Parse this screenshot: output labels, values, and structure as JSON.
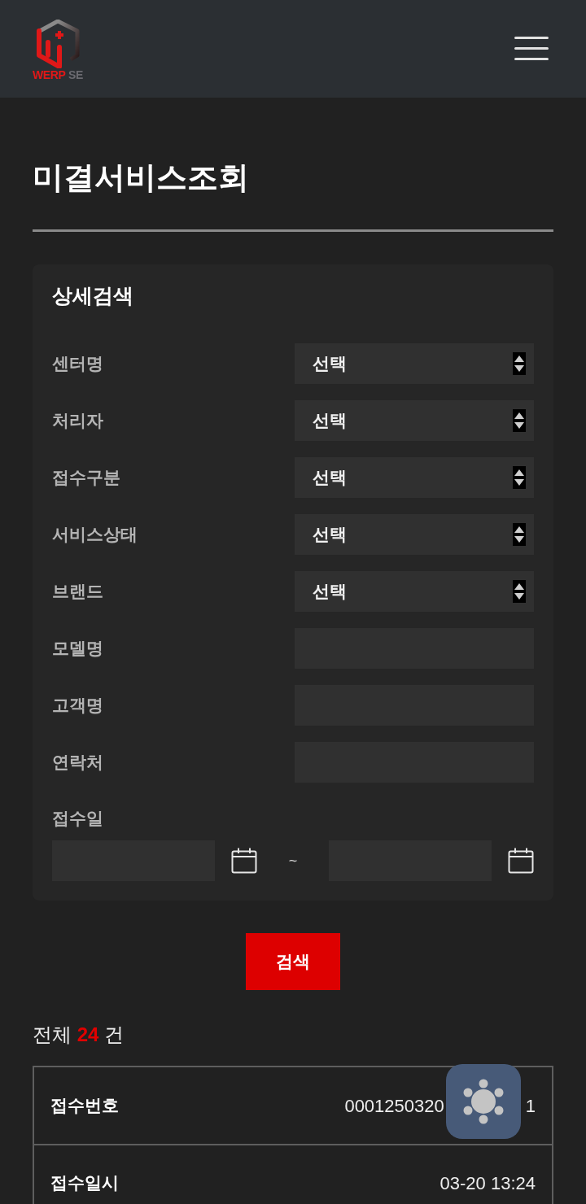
{
  "header": {
    "logo": {
      "brand": "WERP",
      "suffix": "SE"
    }
  },
  "page_title": "미결서비스조회",
  "search_panel": {
    "title": "상세검색",
    "fields": [
      {
        "label": "센터명",
        "kind": "select",
        "value": "선택"
      },
      {
        "label": "처리자",
        "kind": "select",
        "value": "선택"
      },
      {
        "label": "접수구분",
        "kind": "select",
        "value": "선택"
      },
      {
        "label": "서비스상태",
        "kind": "select",
        "value": "선택"
      },
      {
        "label": "브랜드",
        "kind": "select",
        "value": "선택"
      },
      {
        "label": "모델명",
        "kind": "text"
      },
      {
        "label": "고객명",
        "kind": "text"
      },
      {
        "label": "연락처",
        "kind": "text"
      }
    ],
    "date_field": {
      "label": "접수일",
      "separator": "~"
    },
    "search_button": "검색"
  },
  "result_count": {
    "prefix": "전체",
    "count": "24",
    "suffix": "건"
  },
  "results": [
    {
      "label": "접수번호",
      "value": "0001250320",
      "value_tail": "1"
    },
    {
      "label": "접수일시",
      "value": "03-20 13:24"
    }
  ]
}
